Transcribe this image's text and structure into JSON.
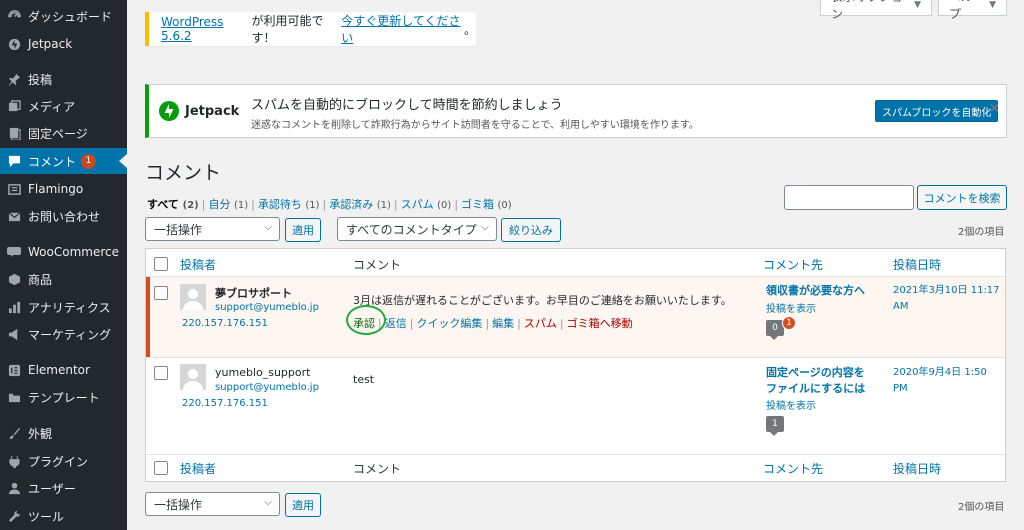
{
  "sidebar": {
    "items": [
      {
        "label": "ダッシュボード",
        "icon": "dashboard-icon"
      },
      {
        "label": "Jetpack",
        "icon": "jetpack-icon"
      },
      {
        "label": "投稿",
        "icon": "pin-icon"
      },
      {
        "label": "メディア",
        "icon": "media-icon"
      },
      {
        "label": "固定ページ",
        "icon": "page-icon"
      },
      {
        "label": "コメント",
        "icon": "comment-icon",
        "badge": "1",
        "active": true
      },
      {
        "label": "Flamingo",
        "icon": "flamingo-icon"
      },
      {
        "label": "お問い合わせ",
        "icon": "mail-icon"
      },
      {
        "label": "WooCommerce",
        "icon": "woocommerce-icon"
      },
      {
        "label": "商品",
        "icon": "products-icon"
      },
      {
        "label": "アナリティクス",
        "icon": "analytics-icon"
      },
      {
        "label": "マーケティング",
        "icon": "marketing-icon"
      },
      {
        "label": "Elementor",
        "icon": "elementor-icon"
      },
      {
        "label": "テンプレート",
        "icon": "folder-icon"
      },
      {
        "label": "外観",
        "icon": "appearance-icon"
      },
      {
        "label": "プラグイン",
        "icon": "plugin-icon"
      },
      {
        "label": "ユーザー",
        "icon": "user-icon"
      },
      {
        "label": "ツール",
        "icon": "tools-icon"
      }
    ]
  },
  "screen_meta": {
    "screen_options": "表示オプション",
    "help": "ヘルプ"
  },
  "update_nag": {
    "version_link": "WordPress 5.6.2",
    "middle": " が利用可能です！",
    "update_link": "今すぐ更新してください",
    "end": "。"
  },
  "jetpack_banner": {
    "logo_text": "Jetpack",
    "title": "スパムを自動的にブロックして時間を節約しましょう",
    "description": "迷惑なコメントを削除して詐欺行為からサイト訪問者を守ることで、利用しやすい環境を作ります。",
    "button": "スパムブロックを自動化",
    "close": "×"
  },
  "page_title": "コメント",
  "filters": [
    {
      "label": "すべて",
      "count": "(2)",
      "current": true
    },
    {
      "label": "自分",
      "count": "(1)"
    },
    {
      "label": "承認待ち",
      "count": "(1)"
    },
    {
      "label": "承認済み",
      "count": "(1)"
    },
    {
      "label": "スパム",
      "count": "(0)"
    },
    {
      "label": "ゴミ箱",
      "count": "(0)"
    }
  ],
  "search": {
    "button": "コメントを検索",
    "value": ""
  },
  "bulk_actions": {
    "label": "一括操作",
    "apply": "適用"
  },
  "comment_type_filter": {
    "label": "すべてのコメントタイプ",
    "button": "絞り込み"
  },
  "items_count": "2個の項目",
  "table": {
    "headers": {
      "author": "投稿者",
      "comment": "コメント",
      "response": "コメント先",
      "date": "投稿日時"
    },
    "rows": [
      {
        "author_name": "夢ブロサポート",
        "author_email": "support@yumeblo.jp",
        "author_ip": "220.157.176.151",
        "comment": "3月は返信が遅れることがございます。お早目のご連絡をお願いいたします。",
        "actions": {
          "approve": "承認",
          "reply": "返信",
          "quick_edit": "クイック編集",
          "edit": "編集",
          "spam": "スパム",
          "trash": "ゴミ箱へ移動"
        },
        "response_title_1": "領収書が必要な方へ",
        "response_view": "投稿を表示",
        "comment_count": "0",
        "pending_count": "1",
        "date_1": "2021年3月10日 11:17",
        "date_2": "AM",
        "status": "pending"
      },
      {
        "author_name": "yumeblo_support",
        "author_email": "support@yumeblo.jp",
        "author_ip": "220.157.176.151",
        "comment": "test",
        "response_title_1": "固定ページの内容を",
        "response_title_2": "ファイルにするには",
        "response_view": "投稿を表示",
        "comment_count": "1",
        "date_1": "2020年9月4日 1:50",
        "date_2": "PM",
        "status": "approved"
      }
    ]
  },
  "colors": {
    "sidebar_bg": "#23282d",
    "accent": "#0073aa",
    "pending_border": "#d54e21",
    "jetpack_green": "#069e08"
  }
}
